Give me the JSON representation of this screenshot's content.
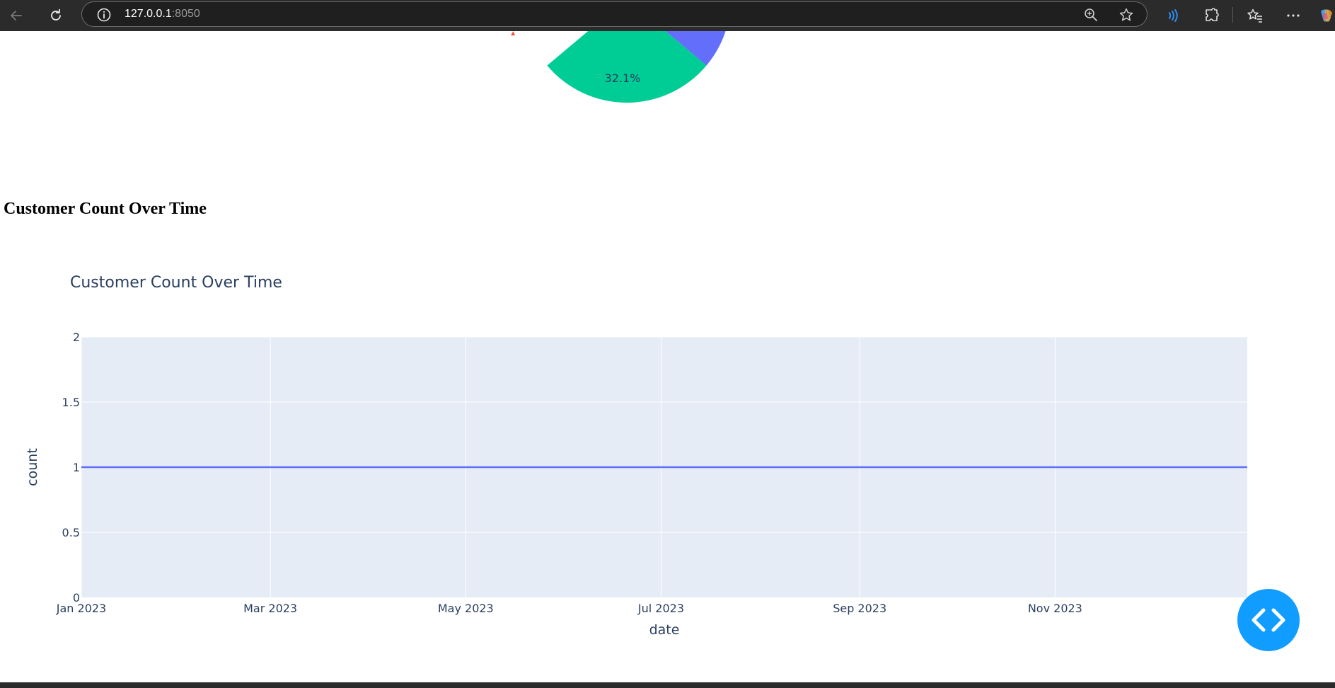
{
  "browser": {
    "url_host": "127.0.0.1",
    "url_port": ":8050"
  },
  "page": {
    "heading": "Customer Count Over Time"
  },
  "pie_chart": {
    "visible_label": "32.1%",
    "colors": {
      "teal": "#00cc96",
      "blue": "#636efa",
      "red": "#ef553b"
    }
  },
  "chart_data": {
    "type": "line",
    "title": "Customer Count Over Time",
    "xlabel": "date",
    "ylabel": "count",
    "x": [
      "2023-01-01",
      "2023-12-31"
    ],
    "series": [
      {
        "values": [
          1,
          1
        ],
        "color": "#636efa"
      }
    ],
    "xlim": [
      "2023-01-01",
      "2023-12-31"
    ],
    "ylim": [
      0,
      2
    ],
    "x_ticks": [
      {
        "date": "2023-01-01",
        "label": "Jan 2023"
      },
      {
        "date": "2023-03-01",
        "label": "Mar 2023"
      },
      {
        "date": "2023-05-01",
        "label": "May 2023"
      },
      {
        "date": "2023-07-01",
        "label": "Jul 2023"
      },
      {
        "date": "2023-09-01",
        "label": "Sep 2023"
      },
      {
        "date": "2023-11-01",
        "label": "Nov 2023"
      }
    ],
    "y_ticks": [
      {
        "value": 0,
        "label": "0"
      },
      {
        "value": 0.5,
        "label": "0.5"
      },
      {
        "value": 1,
        "label": "1"
      },
      {
        "value": 1.5,
        "label": "1.5"
      },
      {
        "value": 2,
        "label": "2"
      }
    ],
    "grid": true,
    "plot_bgcolor": "#e5ecf6"
  }
}
